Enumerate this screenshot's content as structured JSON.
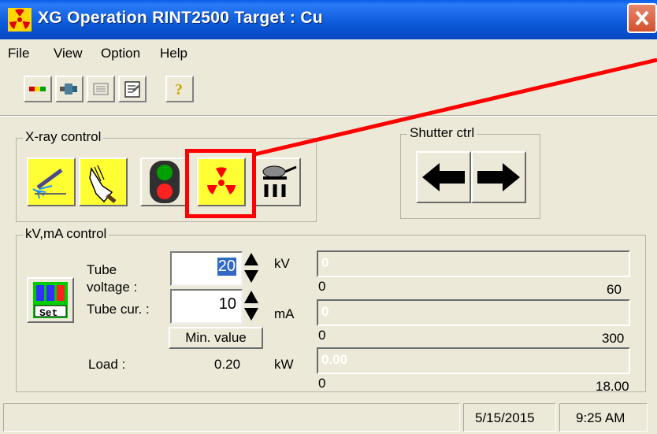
{
  "window": {
    "title": "XG Operation RINT2500  Target : Cu"
  },
  "menu": [
    "File",
    "View",
    "Option",
    "Help"
  ],
  "toolbar_icons": [
    "status-bars-icon",
    "connector-icon",
    "list-icon",
    "properties-icon",
    "help-key-icon"
  ],
  "xray_control": {
    "label": "X-ray control",
    "buttons": [
      "xray-beam-icon",
      "hand-icon",
      "traffic-light-icon",
      "radiation-icon",
      "cooling-icon"
    ]
  },
  "shutter": {
    "label": "Shutter ctrl"
  },
  "kv_ma": {
    "label": "kV,mA control",
    "set_label": "Set",
    "tube_voltage_label_1": "Tube",
    "tube_voltage_label_2": "voltage :",
    "tube_voltage_value": "20",
    "kv_unit": "kV",
    "tube_current_label": "Tube cur. :",
    "tube_current_value": "10",
    "ma_unit": "mA",
    "min_value_label": "Min. value",
    "load_label": "Load :",
    "load_value": "0.20",
    "kw_unit": "kW",
    "bars": [
      {
        "text": "0",
        "min": "0",
        "max": "60",
        "fraction": 0.0
      },
      {
        "text": "0",
        "min": "0",
        "max": "300",
        "fraction": 0.0
      },
      {
        "text": "0.00",
        "min": "0",
        "max": "18.00",
        "fraction": 0.0
      }
    ]
  },
  "status": {
    "date": "5/15/2015",
    "time": "9:25 AM"
  },
  "colors": {
    "title_bar": "#0b5ad9",
    "annotation": "#ff0000",
    "button_yellow": "#ffff33"
  }
}
